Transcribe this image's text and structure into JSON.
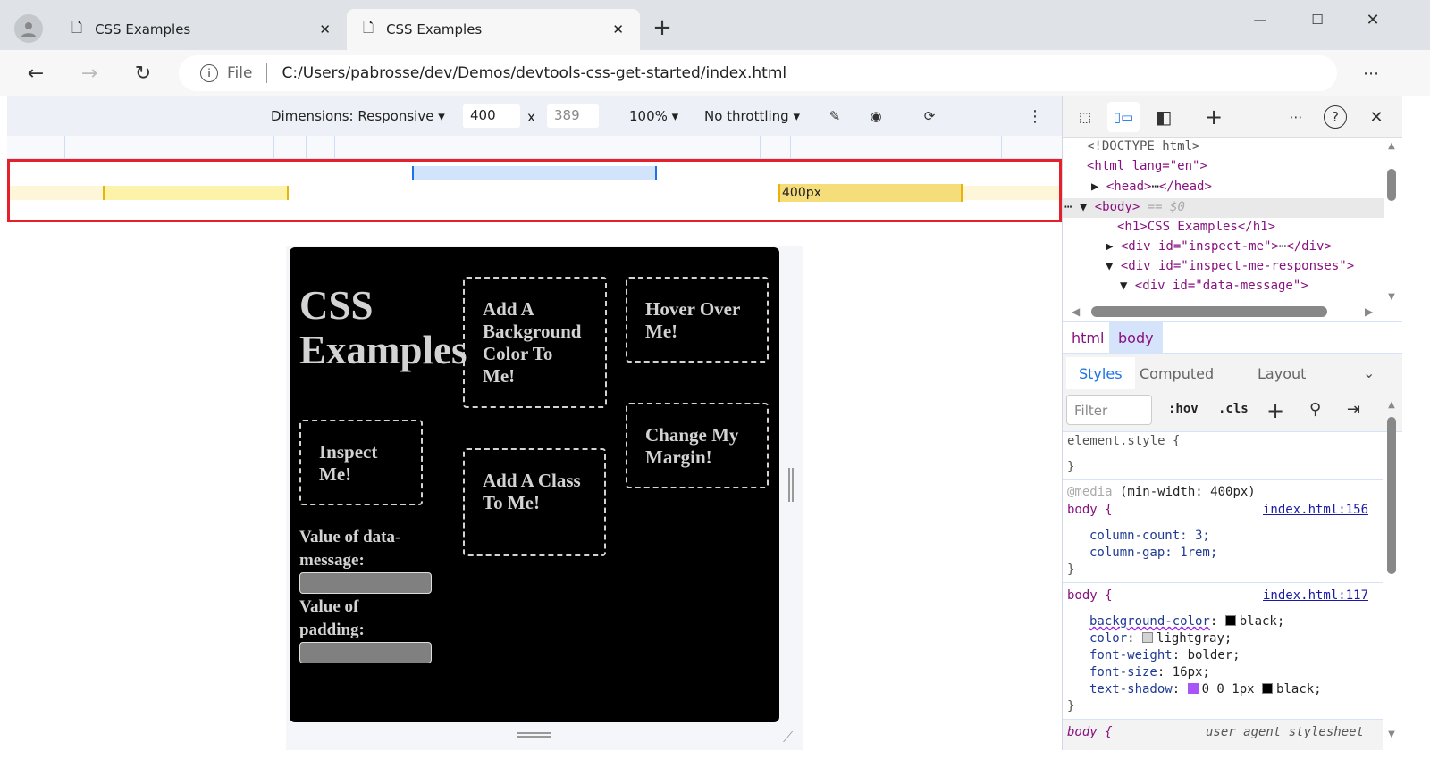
{
  "browser": {
    "tabs": [
      {
        "title": "CSS Examples",
        "active": false
      },
      {
        "title": "CSS Examples",
        "active": true
      }
    ],
    "address": {
      "scheme_label": "File",
      "url": "C:/Users/pabrosse/dev/Demos/devtools-css-get-started/index.html"
    }
  },
  "device_toolbar": {
    "dimensions": "Dimensions: Responsive",
    "width": "400",
    "times": "x",
    "height": "389",
    "zoom": "100%",
    "throttling": "No throttling"
  },
  "media_bar": {
    "label": "400px",
    "colors": {
      "highlight": "#e4202b",
      "min_width": "#f5dd7a",
      "max_width": "#d2e3fc"
    }
  },
  "page": {
    "heading": "CSS Examples",
    "boxes": [
      "Add A Background Color To Me!",
      "Hover Over Me!",
      "Inspect Me!",
      "Change My Margin!",
      "Add A Class To Me!"
    ],
    "label_data_message": "Value of data-message:",
    "label_padding": "Value of padding:"
  },
  "devtools": {
    "dom": {
      "doctype": "<!DOCTYPE html>",
      "html_open": "<html lang=\"en\">",
      "head": "<head>",
      "head_close": "</head>",
      "body": "<body>",
      "body_marker": "== $0",
      "h1": "<h1>CSS Examples</h1>",
      "div1": "<div id=\"inspect-me\">",
      "div1_close": "</div>",
      "div2": "<div id=\"inspect-me-responses\">",
      "div3": "<div id=\"data-message\">"
    },
    "breadcrumbs": [
      "html",
      "body"
    ],
    "tabs": [
      "Styles",
      "Computed",
      "Layout"
    ],
    "filter_placeholder": "Filter",
    "hov": ":hov",
    "cls": ".cls",
    "rules": {
      "element_style": "element.style {",
      "close": "}",
      "media": "@media",
      "media_query": " (min-width: 400px)",
      "r1_selector": "body {",
      "r1_source": "index.html:156",
      "r1_decls": [
        "column-count: 3;",
        "column-gap: 1rem;"
      ],
      "r2_selector": "body {",
      "r2_source": "index.html:117",
      "r2_decls": [
        {
          "prop": "background-color",
          "value": "black;",
          "swatch": "#000000"
        },
        {
          "prop": "color",
          "value": "lightgray;",
          "swatch": "#d3d3d3"
        },
        {
          "prop": "font-weight",
          "value": "bolder;"
        },
        {
          "prop": "font-size",
          "value": "16px;"
        },
        {
          "prop": "text-shadow",
          "value": "0 0 1px",
          "swatch2": "#000000",
          "value2": "black;"
        }
      ],
      "r3_selector": "body {",
      "r3_source": "user agent stylesheet"
    }
  }
}
